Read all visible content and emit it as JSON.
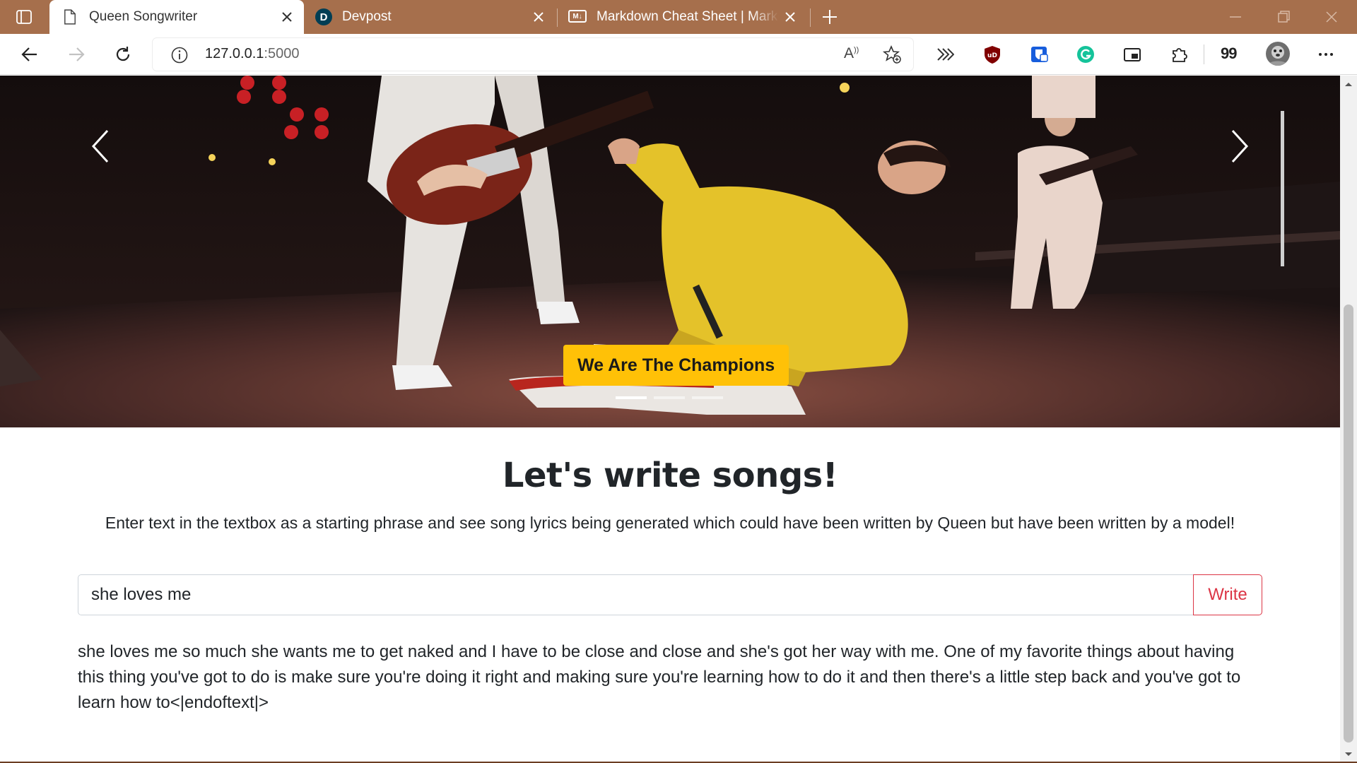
{
  "browser": {
    "tabs": [
      {
        "title": "Queen Songwriter",
        "active": true
      },
      {
        "title": "Devpost",
        "active": false
      },
      {
        "title": "Markdown Cheat Sheet | Markdown",
        "active": false
      }
    ],
    "address": {
      "host": "127.0.0.1",
      "port": ":5000"
    },
    "profile_badge": "99",
    "accent": "#a66f4c"
  },
  "hero": {
    "caption": "We Are The Champions",
    "slides": 3,
    "active_slide": 0,
    "badge_color": "#ffc107"
  },
  "main": {
    "title": "Let's write songs!",
    "description": "Enter text in the textbox as a starting phrase and see song lyrics being generated which could have been written by Queen but have been written by a model!",
    "input_value": "she loves me",
    "write_label": "Write",
    "generated_text": "she loves me so much she wants me to get naked and I have to be close and close and she's got her way with me. One of my favorite things about having this thing you've got to do is make sure you're doing it right and making sure you're learning how to do it and then there's a little step back and you've got to learn how to<|endoftext|>",
    "button_color": "#dc3545"
  }
}
